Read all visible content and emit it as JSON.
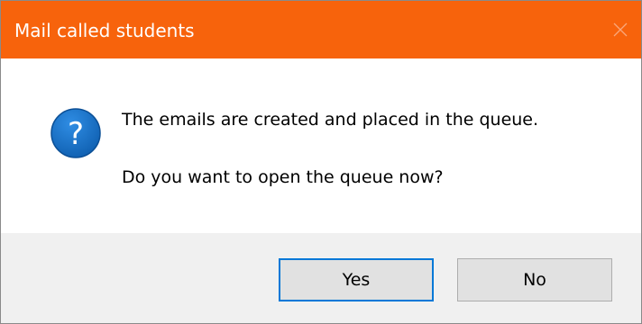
{
  "dialog": {
    "title": "Mail called students",
    "close_icon": "close-icon",
    "accent_color": "#f7630c"
  },
  "message": {
    "icon": "question-icon",
    "line1": "The emails are created and placed in the queue.",
    "line2": "Do you want to open the queue now?"
  },
  "buttons": {
    "yes_label": "Yes",
    "no_label": "No"
  }
}
